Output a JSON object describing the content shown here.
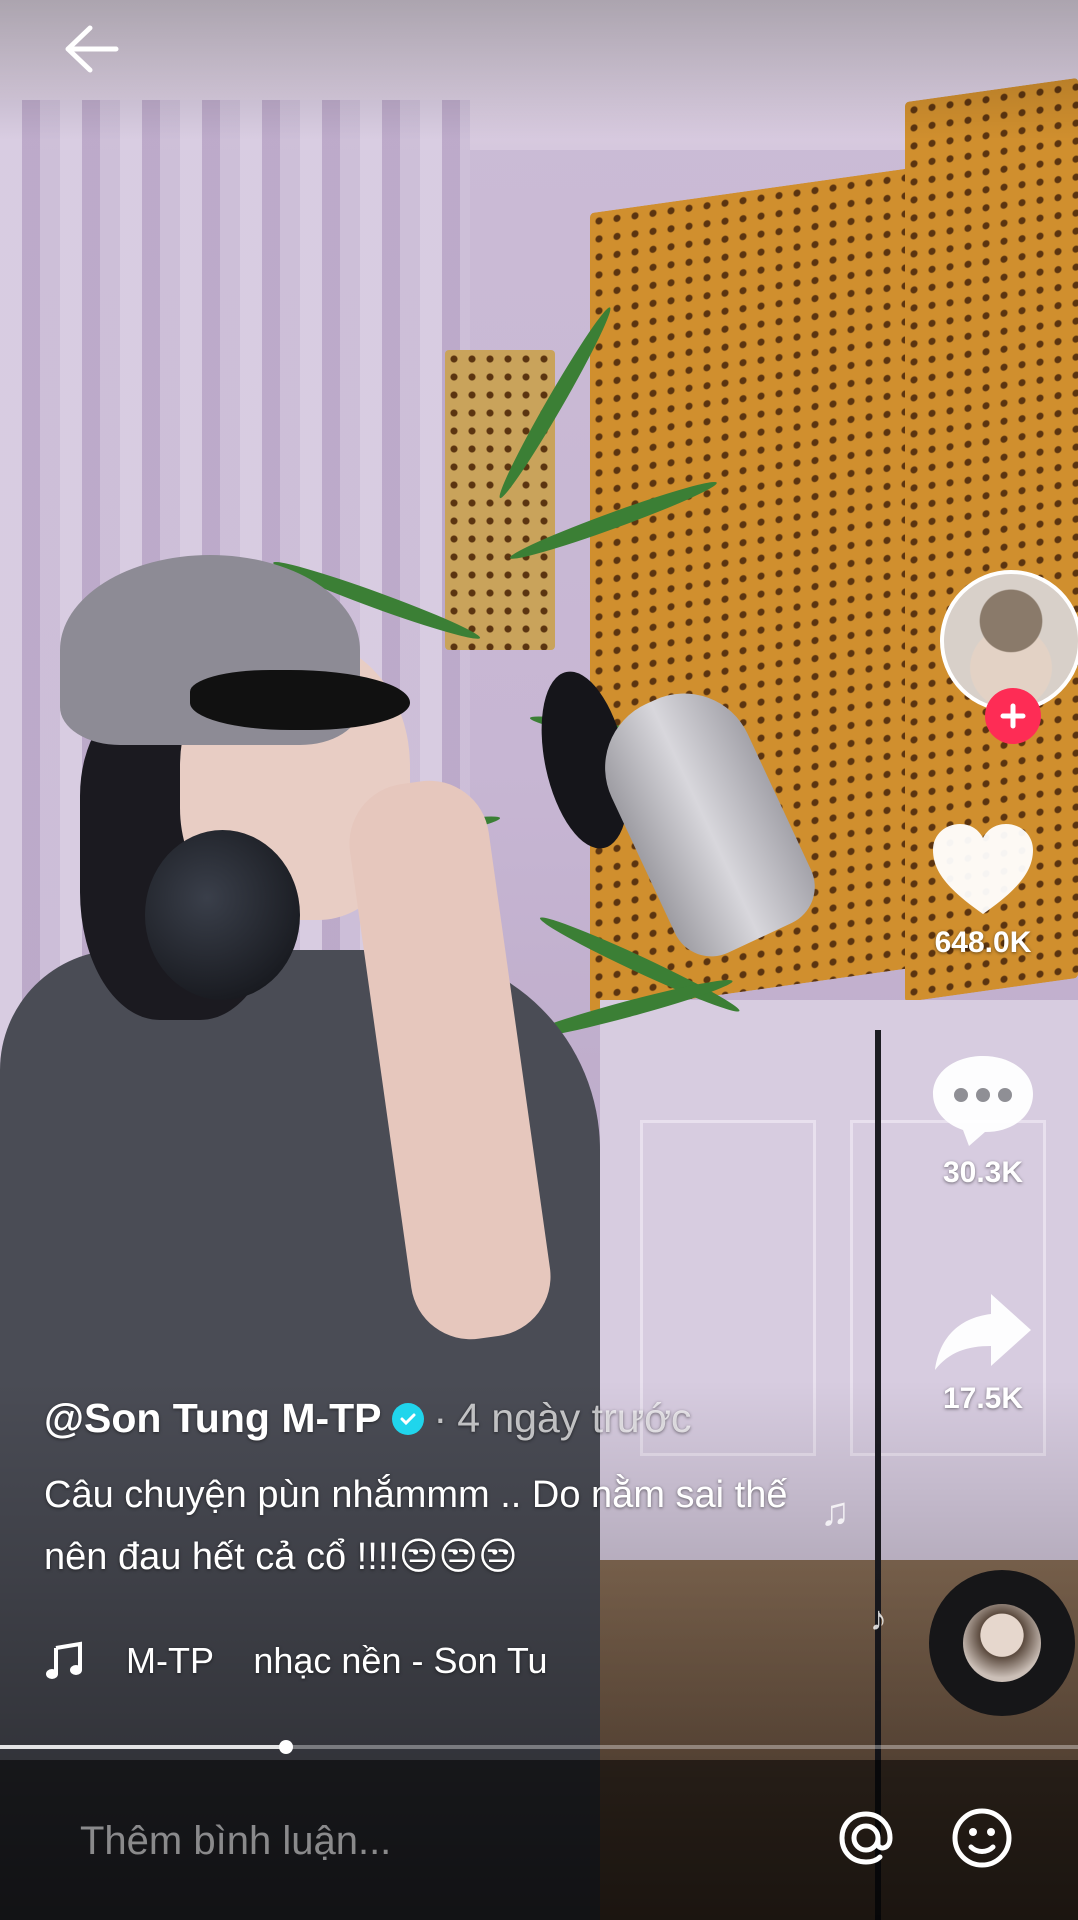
{
  "nav": {
    "back_icon": "arrow-left-icon"
  },
  "rail": {
    "avatar_icon": "profile-avatar",
    "follow_icon": "plus-icon",
    "like": {
      "icon": "heart-icon",
      "count": "648.0K"
    },
    "comment": {
      "icon": "comment-bubble-icon",
      "count": "30.3K"
    },
    "share": {
      "icon": "share-arrow-icon",
      "count": "17.5K"
    },
    "disc_icon": "music-disc-icon"
  },
  "video": {
    "author": "@Son Tung M-TP",
    "verified": true,
    "time_sep": "·",
    "time": "4 ngày trước",
    "caption": "Câu chuyện pùn nhắmmm .. Do nằm sai thế nên đau hết cả cổ !!!!😒😒😒",
    "music": "M-TP    nhạc nền - Son Tu"
  },
  "progress": {
    "fraction": 0.265
  },
  "comment_bar": {
    "placeholder": "Thêm bình luận...",
    "mention_icon": "at-sign-icon",
    "emoji_icon": "emoji-face-icon"
  },
  "colors": {
    "follow_red": "#fe2c55",
    "verified_blue": "#20d5ec"
  }
}
